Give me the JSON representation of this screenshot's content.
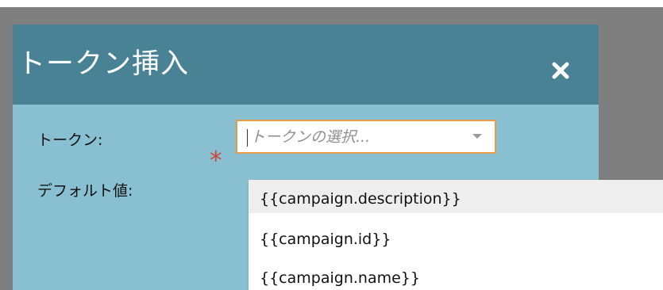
{
  "dialog": {
    "title": "トークン挿入",
    "close_icon": "close-icon"
  },
  "form": {
    "token_label": "トークン:",
    "default_label": "デフォルト値:",
    "required_marker": "*",
    "token_select": {
      "placeholder": "トークンの選択..."
    }
  },
  "dropdown": {
    "options": [
      "{{campaign.description}}",
      "{{campaign.id}}",
      "{{campaign.name}}"
    ],
    "highlighted_index": 0
  },
  "colors": {
    "header": "#4a8295",
    "body": "#88c0d1",
    "overlay": "#7f7f80",
    "required": "#d0463f",
    "focus_border": "#e69b45"
  }
}
